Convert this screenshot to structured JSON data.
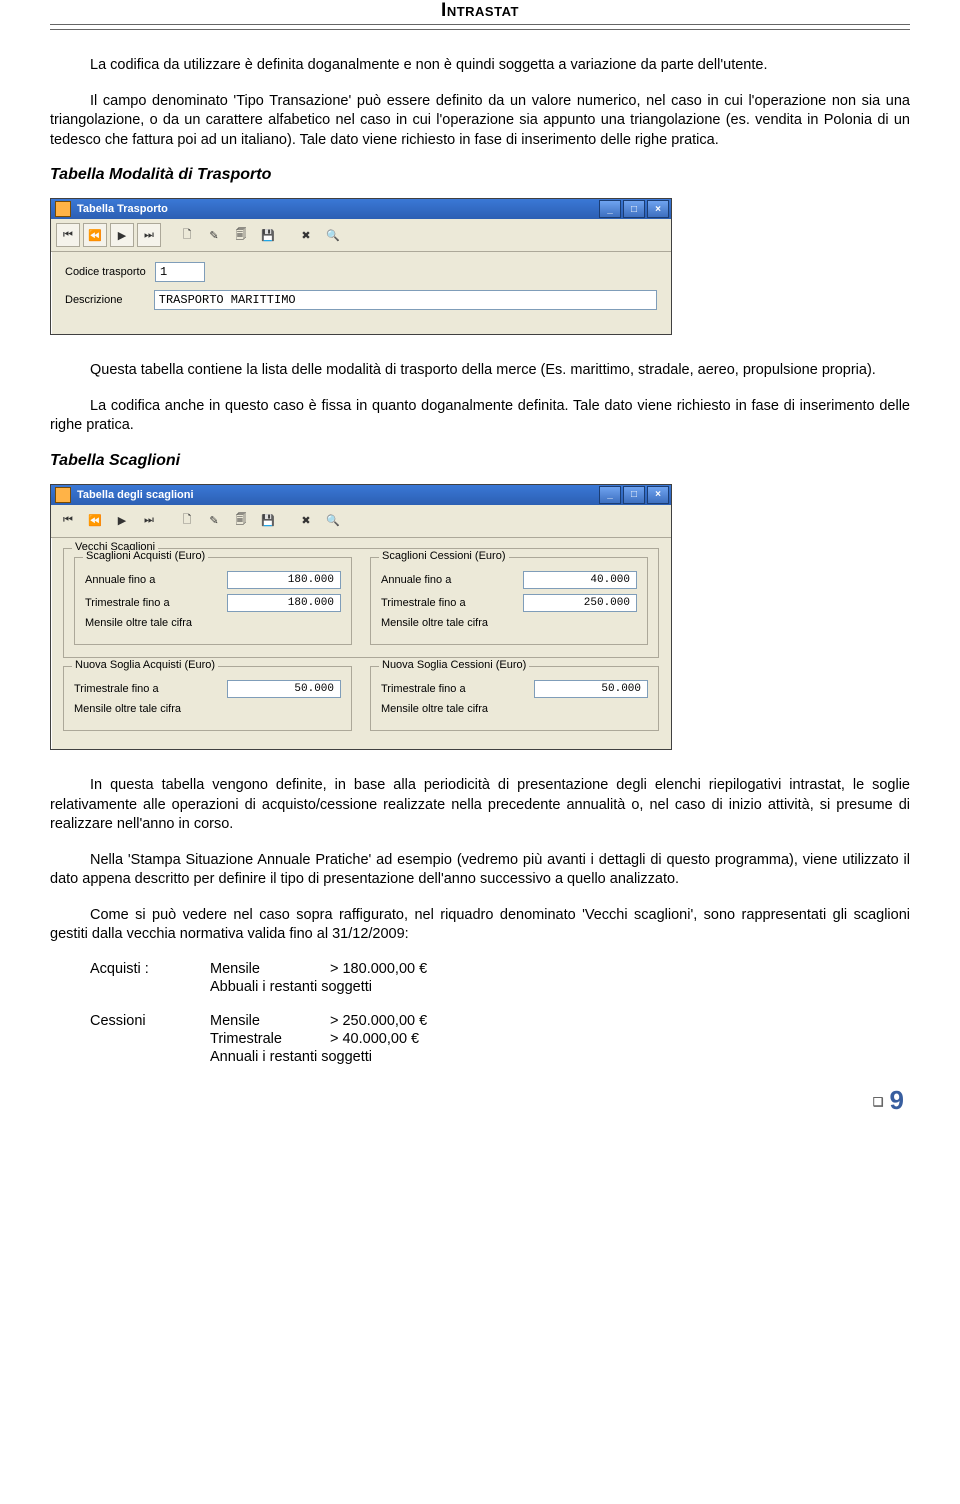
{
  "header": {
    "title": "Intrastat"
  },
  "paragraphs": {
    "p1": "La codifica da utilizzare è definita doganalmente e non è quindi soggetta a variazione da parte dell'utente.",
    "p2": "Il campo denominato 'Tipo Transazione' può essere definito da un valore numerico, nel caso in cui l'operazione non sia una triangolazione, o da un carattere alfabetico nel caso in cui l'operazione sia appunto una triangolazione (es. vendita in Polonia di un tedesco che fattura poi ad un italiano). Tale dato viene richiesto in fase di inserimento delle righe pratica.",
    "p3": "Questa tabella contiene la lista delle modalità di trasporto della merce (Es. marittimo, stradale, aereo, propulsione propria).",
    "p4": "La codifica anche in questo caso è fissa in quanto doganalmente definita. Tale dato viene richiesto in fase di inserimento delle righe pratica.",
    "p5": "In questa tabella vengono definite, in base alla periodicità di presentazione degli elenchi riepilogativi intrastat, le soglie relativamente alle operazioni di acquisto/cessione realizzate nella precedente annualità o, nel caso di inizio attività, si presume di realizzare nell'anno in corso.",
    "p6": "Nella 'Stampa Situazione Annuale Pratiche' ad esempio (vedremo più avanti i dettagli di questo programma), viene utilizzato il dato appena descritto per definire il tipo di presentazione dell'anno successivo a quello analizzato.",
    "p7": "Come si può vedere nel caso sopra raffigurato, nel riquadro denominato 'Vecchi scaglioni', sono rappresentati gli scaglioni gestiti dalla vecchia normativa valida fino al 31/12/2009:"
  },
  "sections": {
    "trasporto_title": "Tabella Modalità di Trasporto",
    "scaglioni_title": "Tabella Scaglioni"
  },
  "win1": {
    "title": "Tabella Trasporto",
    "min": "_",
    "max": "□",
    "close": "×",
    "label_codice": "Codice trasporto",
    "label_descr": "Descrizione",
    "val_codice": "1",
    "val_descr": "TRASPORTO MARITTIMO"
  },
  "win2": {
    "title": "Tabella degli scaglioni",
    "min": "_",
    "max": "□",
    "close": "×",
    "vecchi_legend": "Vecchi Scaglioni",
    "acq_legend": "Scaglioni Acquisti (Euro)",
    "ces_legend": "Scaglioni Cessioni (Euro)",
    "nuova_acq_legend": "Nuova Soglia Acquisti (Euro)",
    "nuova_ces_legend": "Nuova Soglia Cessioni (Euro)",
    "lbl_annuale": "Annuale fino a",
    "lbl_trimestrale": "Trimestrale fino a",
    "lbl_mensile": "Mensile oltre tale cifra",
    "acq_annuale": "180.000",
    "acq_trimestrale": "180.000",
    "ces_annuale": "40.000",
    "ces_trimestrale": "250.000",
    "nuova_acq_trim": "50.000",
    "nuova_ces_trim": "50.000"
  },
  "bottom": {
    "acq_label": "Acquisti :",
    "acq_l1_c2": "Mensile",
    "acq_l1_c3": "> 180.000,00 €",
    "acq_l2_c3": "Abbuali i restanti soggetti",
    "ces_label": "Cessioni",
    "ces_l1_c2": "Mensile",
    "ces_l1_c3": "> 250.000,00 €",
    "ces_l2_c2": "Trimestrale",
    "ces_l2_c3": "> 40.000,00 €",
    "ces_l3_c3": "Annuali i restanti soggetti"
  },
  "footer": {
    "page": "9"
  },
  "icons": {
    "first": "⏮",
    "prev": "⏪",
    "play": "▶",
    "last": "⏭",
    "new": "🗋",
    "edit": "✎",
    "copy": "🗐",
    "save": "💾",
    "delete": "✖",
    "search": "🔍"
  }
}
